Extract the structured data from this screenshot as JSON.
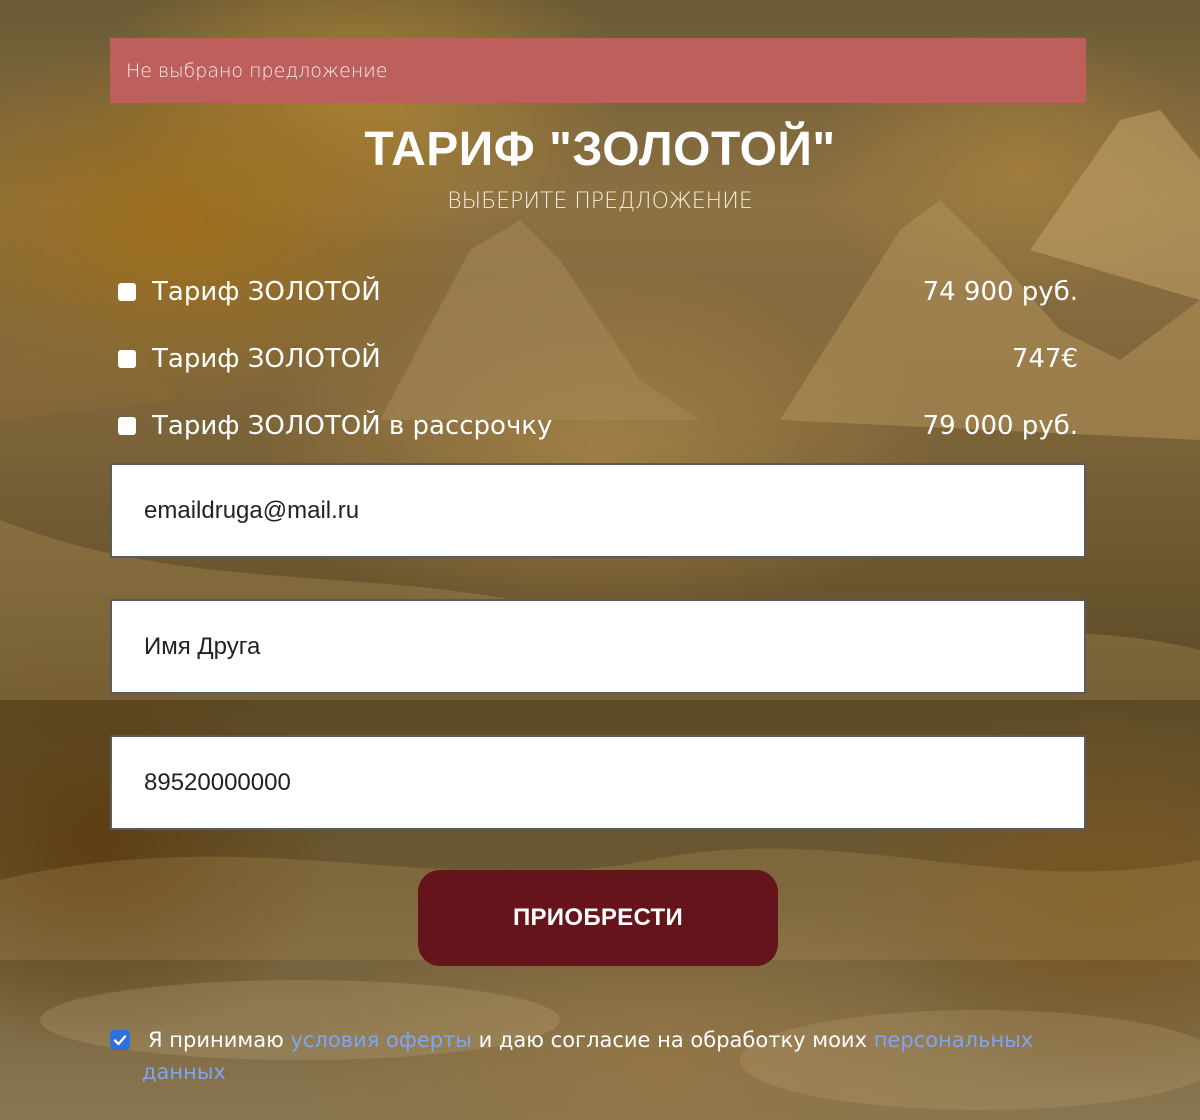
{
  "alert": {
    "text": "Не выбрано предложение"
  },
  "header": {
    "title": "ТАРИФ \"ЗОЛОТОЙ\"",
    "subtitle": "ВЫБЕРИТЕ ПРЕДЛОЖЕНИЕ"
  },
  "offers": [
    {
      "name": "Тариф ЗОЛОТОЙ",
      "price": "74 900 руб.",
      "checked": false
    },
    {
      "name": "Тариф ЗОЛОТОЙ",
      "price": "747€",
      "checked": false
    },
    {
      "name": "Тариф ЗОЛОТОЙ в рассрочку",
      "price": "79 000 руб.",
      "checked": false
    }
  ],
  "form": {
    "email_value": "emaildruga@mail.ru",
    "name_value": "Имя Друга",
    "phone_value": "89520000000",
    "submit_label": "ПРИОБРЕСТИ"
  },
  "consent": {
    "checked": true,
    "text_before": "Я принимаю",
    "link_offer": "условия оферты",
    "text_middle": "и даю согласие на обработку моих",
    "link_personal": "персональных данных"
  },
  "colors": {
    "alert_bg": "#bd5f5c",
    "button_bg": "#65141b",
    "link": "#7ea5f2",
    "checkbox_checked": "#2f6fe0"
  }
}
